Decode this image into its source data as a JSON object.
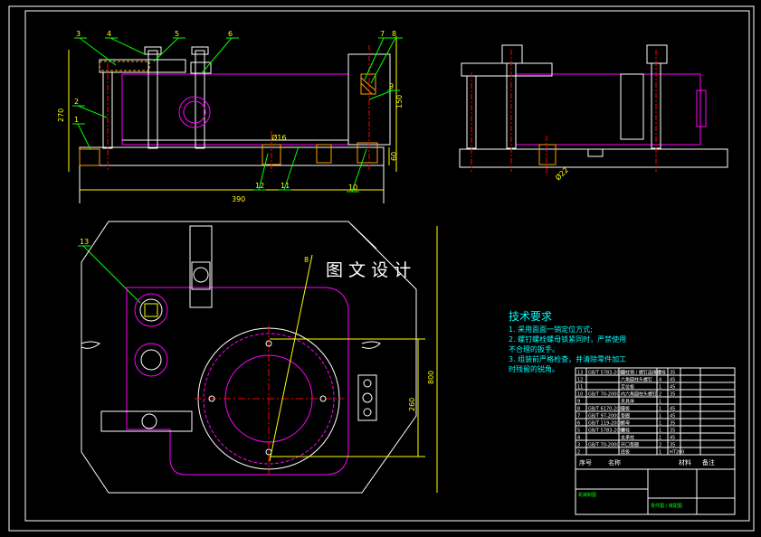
{
  "colors": {
    "background": "#000000",
    "frame": "#ffffff",
    "part": "#ff00ff",
    "leader": "#00ff00",
    "balloon": "#ffff00",
    "dimension": "#ffff00",
    "centerline": "#ff0000",
    "notes": "#00ffff",
    "hatch": "#ffa000"
  },
  "watermark": "图 文 设 计",
  "balloons": {
    "front_top": [
      "3",
      "4",
      "5",
      "6",
      "7",
      "8"
    ],
    "front_left": [
      "1",
      "2"
    ],
    "front_right": [
      "9"
    ],
    "front_bottom": [
      "10",
      "11",
      "12"
    ],
    "plan": [
      "13"
    ]
  },
  "dimensions": {
    "overall_height": "270",
    "overall_width": "390",
    "right_height": "150",
    "base_height": "60",
    "bore_label": "Ø16",
    "plan_inner": "260",
    "plan_outer": "800",
    "side_bore": "Ø22",
    "small_label": "8"
  },
  "notes": {
    "title": "技术要求",
    "lines": [
      "1. 采用面面一销定位方式;",
      "2. 螺钉螺栓螺母锁紧同时，严禁使用",
      "不合理的扳手。",
      "3. 组装前严格检查，并清除零件加工",
      "时残留的锐角。"
    ]
  },
  "bom": {
    "header": [
      "序号",
      "名称",
      "材料",
      "备注"
    ],
    "rows": [
      [
        "13",
        "GB/T 5783-2000",
        "圆柱销 / 螺钉连接螺栓",
        "1",
        "35"
      ],
      [
        "12",
        "",
        "六角圆柱头螺钉",
        "4",
        "45"
      ],
      [
        "11",
        "",
        "定位板",
        "1",
        "45"
      ],
      [
        "10",
        "GB/T 70-2000",
        "内六角圆柱头螺钉",
        "2",
        "35"
      ],
      [
        "9",
        "",
        "夹具体",
        "1",
        ""
      ],
      [
        "8",
        "GB/T 6170-2000",
        "压板",
        "1",
        "45"
      ],
      [
        "7",
        "GB/T 97-2000",
        "垫圈",
        "1",
        "45"
      ],
      [
        "6",
        "GB/T 119-2000",
        "螺母",
        "1",
        "35"
      ],
      [
        "5",
        "GB/T 5783-2000",
        "螺栓",
        "1",
        "35"
      ],
      [
        "4",
        "",
        "支承柱",
        "1",
        "45"
      ],
      [
        "3",
        "GB/T 70-2000",
        "开口垫圈",
        "2",
        "35"
      ],
      [
        "2",
        "",
        "底板",
        "1",
        "HT200"
      ]
    ],
    "title_block_left": "机械制图",
    "title_block_right": "零件图 / 装配图"
  }
}
